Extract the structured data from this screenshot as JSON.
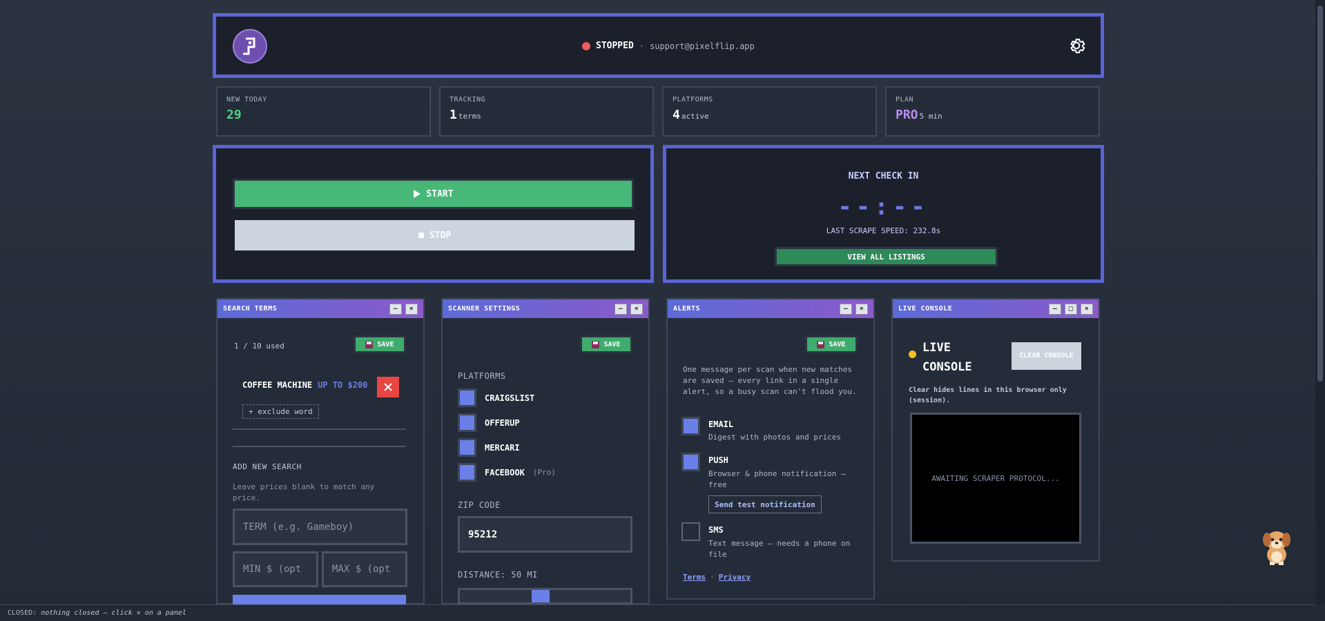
{
  "header": {
    "status": "STOPPED",
    "separator": "·",
    "email": "support@pixelflip.app"
  },
  "stats": [
    {
      "label": "NEW TODAY",
      "value": "29",
      "suffix": ""
    },
    {
      "label": "TRACKING",
      "value": "1",
      "suffix": "terms"
    },
    {
      "label": "PLATFORMS",
      "value": "4",
      "suffix": "active"
    },
    {
      "label": "PLAN",
      "value": "PRO",
      "suffix": "5 min"
    }
  ],
  "control": {
    "start_label": "START",
    "stop_label": "STOP"
  },
  "timer": {
    "title": "NEXT CHECK IN",
    "value": "--:--",
    "speed": "LAST SCRAPE SPEED: 232.8s",
    "listings_label": "VIEW ALL LISTINGS"
  },
  "search_terms": {
    "title": "SEARCH TERMS",
    "save_label": "SAVE",
    "used": "1 / 10 used",
    "term": "COFFEE MACHINE",
    "price": "UP TO $200",
    "exclude_label": "+ exclude word",
    "add_title": "ADD NEW SEARCH",
    "add_hint": "Leave prices blank to match any price.",
    "term_placeholder": "TERM (e.g. Gameboy)",
    "min_placeholder": "MIN $ (opt",
    "max_placeholder": "MAX $ (opt"
  },
  "scanner": {
    "title": "SCANNER SETTINGS",
    "save_label": "SAVE",
    "platforms_label": "PLATFORMS",
    "platforms": [
      {
        "name": "CRAIGSLIST",
        "note": ""
      },
      {
        "name": "OFFERUP",
        "note": ""
      },
      {
        "name": "MERCARI",
        "note": ""
      },
      {
        "name": "FACEBOOK",
        "note": "(Pro)"
      }
    ],
    "zip_label": "ZIP CODE",
    "zip_value": "95212",
    "distance_label": "DISTANCE: 50 MI"
  },
  "alerts": {
    "title": "ALERTS",
    "save_label": "SAVE",
    "description": "One message per scan when new matches are saved — every link in a single alert, so a busy scan can't flood you.",
    "email_label": "EMAIL",
    "email_desc": "Digest with photos and prices",
    "push_label": "PUSH",
    "push_desc": "Browser & phone notification — free",
    "test_label": "Send test notification",
    "sms_label": "SMS",
    "sms_desc": "Text message — needs a phone on file",
    "terms_label": "Terms",
    "dot": "·",
    "privacy_label": "Privacy"
  },
  "console": {
    "title": "LIVE CONSOLE",
    "heading": "LIVE CONSOLE",
    "clear_label": "CLEAR CONSOLE",
    "hint": "Clear hides lines in this browser only (session).",
    "screen_text": "AWAITING SCRAPER PROTOCOL..."
  },
  "footer": {
    "label": "CLOSED:",
    "text": "nothing closed — click × on a panel"
  },
  "window_buttons": {
    "minimize": "–",
    "maximize": "□",
    "close": "×"
  },
  "colors": {
    "accent": "#5b64d6",
    "start": "#48b878",
    "status_stopped": "#ef5b5b",
    "console_dot": "#f0c020"
  }
}
